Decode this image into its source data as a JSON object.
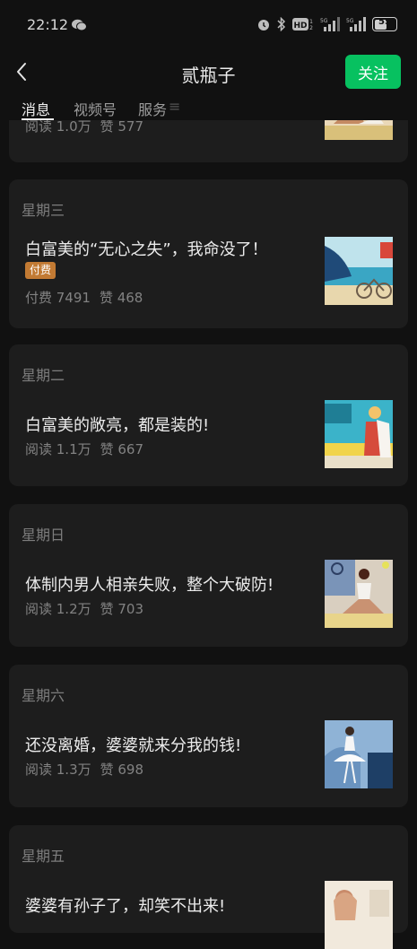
{
  "status_bar": {
    "time": "22:12",
    "battery": "55",
    "network_labels": [
      "HD",
      "5G",
      "5G"
    ]
  },
  "header": {
    "title": "贰瓶子",
    "follow_label": "关注"
  },
  "tabs": [
    {
      "label": "消息",
      "active": true
    },
    {
      "label": "视频号",
      "active": false
    },
    {
      "label": "服务",
      "active": false
    }
  ],
  "articles": [
    {
      "day": "",
      "title": "",
      "stat1": "阅读 1.0万",
      "stat2": "赞 577",
      "paid": false,
      "thumb_icon": "yoga-illustration"
    },
    {
      "day": "星期三",
      "title": "白富美的“无心之失”，我命没了！",
      "paid_label": "付费",
      "stat1": "付费 7491",
      "stat2": "赞 468",
      "paid": true,
      "thumb_icon": "beach-bicycle-illustration"
    },
    {
      "day": "星期二",
      "title": "白富美的敞亮，都是装的!",
      "stat1": "阅读 1.1万",
      "stat2": "赞 667",
      "paid": false,
      "thumb_icon": "seaside-couple-illustration"
    },
    {
      "day": "星期日",
      "title": "体制内男人相亲失败，整个大破防!",
      "stat1": "阅读 1.2万",
      "stat2": "赞 703",
      "paid": false,
      "thumb_icon": "yoga-illustration"
    },
    {
      "day": "星期六",
      "title": "还没离婚，婆婆就来分我的钱!",
      "stat1": "阅读 1.3万",
      "stat2": "赞 698",
      "paid": false,
      "thumb_icon": "ballet-illustration"
    },
    {
      "day": "星期五",
      "title": "婆婆有孙子了，却笑不出来!",
      "paid": false,
      "thumb_icon": "woman-portrait-illustration"
    }
  ],
  "colors": {
    "accent": "#07c160",
    "paid_badge": "#c27a33",
    "background": "#111111",
    "card": "#1d1d1d"
  }
}
